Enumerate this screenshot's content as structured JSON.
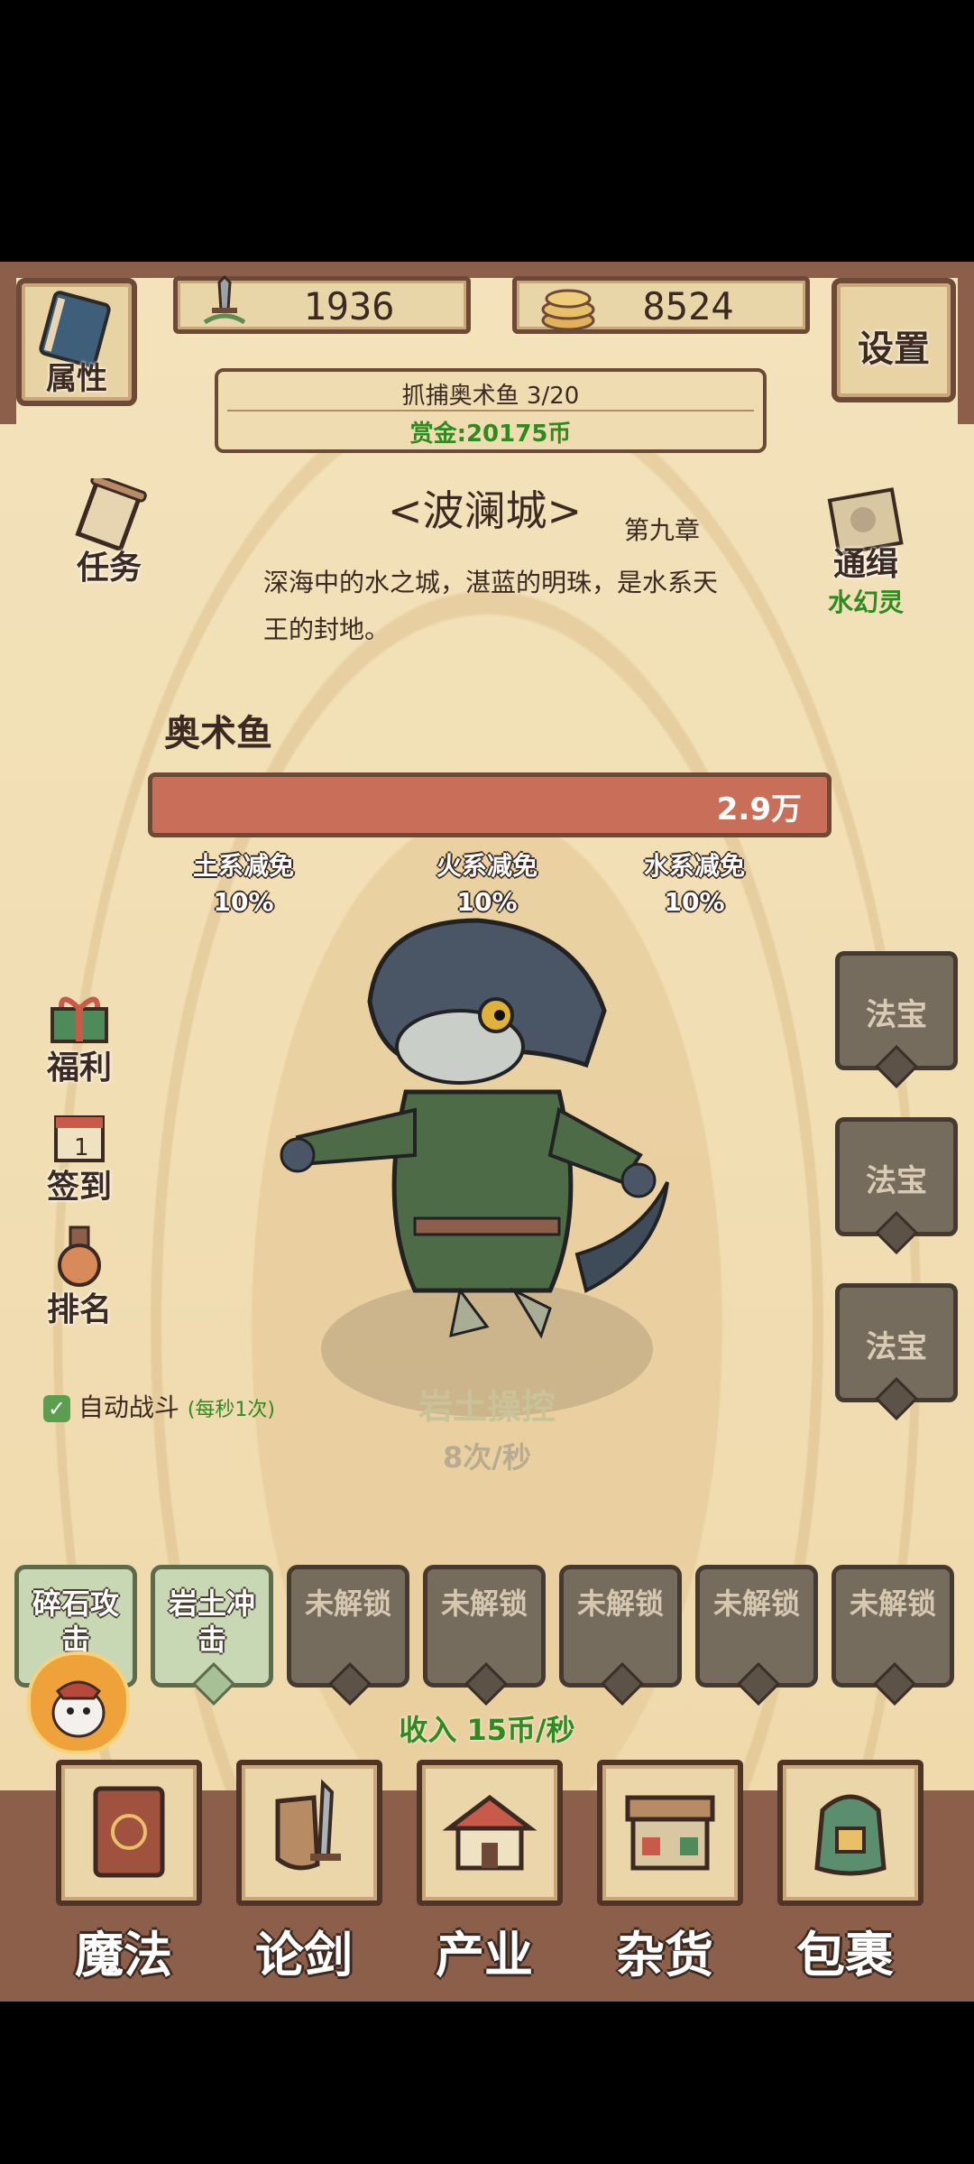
{
  "header": {
    "attributes_label": "属性",
    "power_value": "1936",
    "coins_value": "8524",
    "settings_label": "设置"
  },
  "quest": {
    "title": "抓捕奥术鱼 3/20",
    "reward": "赏金:20175币"
  },
  "city": {
    "name": "<波澜城>",
    "chapter": "第九章",
    "description": "深海中的水之城，湛蓝的明珠，是水系天王的封地。"
  },
  "left_menu": {
    "task_label": "任务",
    "welfare_label": "福利",
    "signin_label": "签到",
    "rank_label": "排名"
  },
  "wanted": {
    "label": "通缉",
    "target": "水幻灵"
  },
  "boss": {
    "name": "奥术鱼",
    "hp_text": "2.9万",
    "hp_fraction": 1.0,
    "resistances": [
      {
        "name": "土系减免",
        "value": "10%"
      },
      {
        "name": "火系减免",
        "value": "10%"
      },
      {
        "name": "水系减免",
        "value": "10%"
      }
    ]
  },
  "treasures": [
    "法宝",
    "法宝",
    "法宝"
  ],
  "auto_battle": {
    "label": "自动战斗",
    "rate": "(每秒1次)",
    "checked": true
  },
  "current_skill": {
    "name": "岩土操控",
    "rate": "8次/秒"
  },
  "skills": [
    {
      "label": "碎石攻击",
      "unlocked": true
    },
    {
      "label": "岩土冲击",
      "unlocked": true
    },
    {
      "label": "未解锁",
      "unlocked": false
    },
    {
      "label": "未解锁",
      "unlocked": false
    },
    {
      "label": "未解锁",
      "unlocked": false
    },
    {
      "label": "未解锁",
      "unlocked": false
    },
    {
      "label": "未解锁",
      "unlocked": false
    }
  ],
  "income": "收入 15币/秒",
  "bottom_nav": [
    "魔法",
    "论剑",
    "产业",
    "杂货",
    "包裹"
  ],
  "colors": {
    "background": "#f2dfb4",
    "frame": "#8b5f49",
    "hp_bar": "#c96e59",
    "reward_green": "#2f8a20",
    "locked_slot": "#766c5e"
  }
}
